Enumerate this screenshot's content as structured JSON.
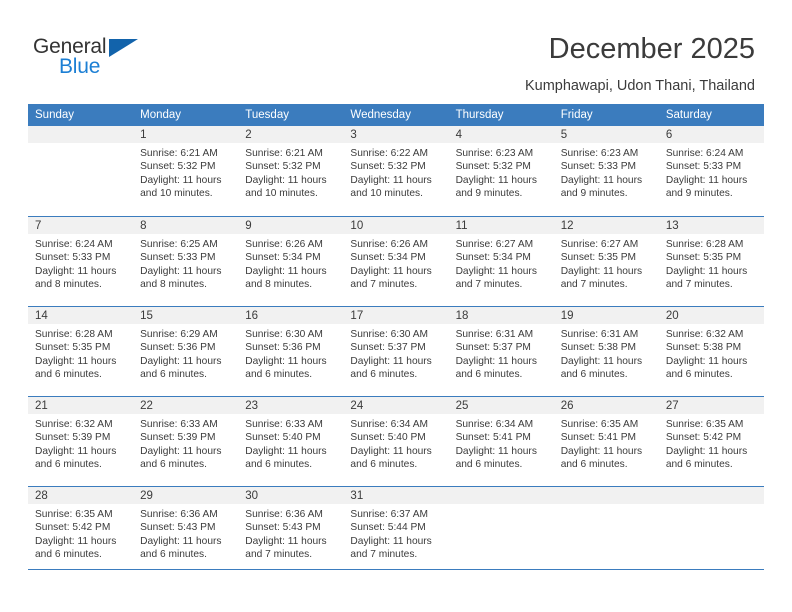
{
  "brand": {
    "name_part1": "General",
    "name_part2": "Blue",
    "accent_color": "#1c7fd4",
    "triangle_color": "#1263ab"
  },
  "header": {
    "title": "December 2025",
    "subtitle": "Kumphawapi, Udon Thani, Thailand"
  },
  "calendar": {
    "header_bg": "#3b7cbe",
    "daynum_bg": "#f1f1f1",
    "weekdays": [
      "Sunday",
      "Monday",
      "Tuesday",
      "Wednesday",
      "Thursday",
      "Friday",
      "Saturday"
    ],
    "weeks": [
      [
        {
          "day": "",
          "sunrise": "",
          "sunset": "",
          "daylight_line1": "",
          "daylight_line2": ""
        },
        {
          "day": "1",
          "sunrise": "Sunrise: 6:21 AM",
          "sunset": "Sunset: 5:32 PM",
          "daylight_line1": "Daylight: 11 hours",
          "daylight_line2": "and 10 minutes."
        },
        {
          "day": "2",
          "sunrise": "Sunrise: 6:21 AM",
          "sunset": "Sunset: 5:32 PM",
          "daylight_line1": "Daylight: 11 hours",
          "daylight_line2": "and 10 minutes."
        },
        {
          "day": "3",
          "sunrise": "Sunrise: 6:22 AM",
          "sunset": "Sunset: 5:32 PM",
          "daylight_line1": "Daylight: 11 hours",
          "daylight_line2": "and 10 minutes."
        },
        {
          "day": "4",
          "sunrise": "Sunrise: 6:23 AM",
          "sunset": "Sunset: 5:32 PM",
          "daylight_line1": "Daylight: 11 hours",
          "daylight_line2": "and 9 minutes."
        },
        {
          "day": "5",
          "sunrise": "Sunrise: 6:23 AM",
          "sunset": "Sunset: 5:33 PM",
          "daylight_line1": "Daylight: 11 hours",
          "daylight_line2": "and 9 minutes."
        },
        {
          "day": "6",
          "sunrise": "Sunrise: 6:24 AM",
          "sunset": "Sunset: 5:33 PM",
          "daylight_line1": "Daylight: 11 hours",
          "daylight_line2": "and 9 minutes."
        }
      ],
      [
        {
          "day": "7",
          "sunrise": "Sunrise: 6:24 AM",
          "sunset": "Sunset: 5:33 PM",
          "daylight_line1": "Daylight: 11 hours",
          "daylight_line2": "and 8 minutes."
        },
        {
          "day": "8",
          "sunrise": "Sunrise: 6:25 AM",
          "sunset": "Sunset: 5:33 PM",
          "daylight_line1": "Daylight: 11 hours",
          "daylight_line2": "and 8 minutes."
        },
        {
          "day": "9",
          "sunrise": "Sunrise: 6:26 AM",
          "sunset": "Sunset: 5:34 PM",
          "daylight_line1": "Daylight: 11 hours",
          "daylight_line2": "and 8 minutes."
        },
        {
          "day": "10",
          "sunrise": "Sunrise: 6:26 AM",
          "sunset": "Sunset: 5:34 PM",
          "daylight_line1": "Daylight: 11 hours",
          "daylight_line2": "and 7 minutes."
        },
        {
          "day": "11",
          "sunrise": "Sunrise: 6:27 AM",
          "sunset": "Sunset: 5:34 PM",
          "daylight_line1": "Daylight: 11 hours",
          "daylight_line2": "and 7 minutes."
        },
        {
          "day": "12",
          "sunrise": "Sunrise: 6:27 AM",
          "sunset": "Sunset: 5:35 PM",
          "daylight_line1": "Daylight: 11 hours",
          "daylight_line2": "and 7 minutes."
        },
        {
          "day": "13",
          "sunrise": "Sunrise: 6:28 AM",
          "sunset": "Sunset: 5:35 PM",
          "daylight_line1": "Daylight: 11 hours",
          "daylight_line2": "and 7 minutes."
        }
      ],
      [
        {
          "day": "14",
          "sunrise": "Sunrise: 6:28 AM",
          "sunset": "Sunset: 5:35 PM",
          "daylight_line1": "Daylight: 11 hours",
          "daylight_line2": "and 6 minutes."
        },
        {
          "day": "15",
          "sunrise": "Sunrise: 6:29 AM",
          "sunset": "Sunset: 5:36 PM",
          "daylight_line1": "Daylight: 11 hours",
          "daylight_line2": "and 6 minutes."
        },
        {
          "day": "16",
          "sunrise": "Sunrise: 6:30 AM",
          "sunset": "Sunset: 5:36 PM",
          "daylight_line1": "Daylight: 11 hours",
          "daylight_line2": "and 6 minutes."
        },
        {
          "day": "17",
          "sunrise": "Sunrise: 6:30 AM",
          "sunset": "Sunset: 5:37 PM",
          "daylight_line1": "Daylight: 11 hours",
          "daylight_line2": "and 6 minutes."
        },
        {
          "day": "18",
          "sunrise": "Sunrise: 6:31 AM",
          "sunset": "Sunset: 5:37 PM",
          "daylight_line1": "Daylight: 11 hours",
          "daylight_line2": "and 6 minutes."
        },
        {
          "day": "19",
          "sunrise": "Sunrise: 6:31 AM",
          "sunset": "Sunset: 5:38 PM",
          "daylight_line1": "Daylight: 11 hours",
          "daylight_line2": "and 6 minutes."
        },
        {
          "day": "20",
          "sunrise": "Sunrise: 6:32 AM",
          "sunset": "Sunset: 5:38 PM",
          "daylight_line1": "Daylight: 11 hours",
          "daylight_line2": "and 6 minutes."
        }
      ],
      [
        {
          "day": "21",
          "sunrise": "Sunrise: 6:32 AM",
          "sunset": "Sunset: 5:39 PM",
          "daylight_line1": "Daylight: 11 hours",
          "daylight_line2": "and 6 minutes."
        },
        {
          "day": "22",
          "sunrise": "Sunrise: 6:33 AM",
          "sunset": "Sunset: 5:39 PM",
          "daylight_line1": "Daylight: 11 hours",
          "daylight_line2": "and 6 minutes."
        },
        {
          "day": "23",
          "sunrise": "Sunrise: 6:33 AM",
          "sunset": "Sunset: 5:40 PM",
          "daylight_line1": "Daylight: 11 hours",
          "daylight_line2": "and 6 minutes."
        },
        {
          "day": "24",
          "sunrise": "Sunrise: 6:34 AM",
          "sunset": "Sunset: 5:40 PM",
          "daylight_line1": "Daylight: 11 hours",
          "daylight_line2": "and 6 minutes."
        },
        {
          "day": "25",
          "sunrise": "Sunrise: 6:34 AM",
          "sunset": "Sunset: 5:41 PM",
          "daylight_line1": "Daylight: 11 hours",
          "daylight_line2": "and 6 minutes."
        },
        {
          "day": "26",
          "sunrise": "Sunrise: 6:35 AM",
          "sunset": "Sunset: 5:41 PM",
          "daylight_line1": "Daylight: 11 hours",
          "daylight_line2": "and 6 minutes."
        },
        {
          "day": "27",
          "sunrise": "Sunrise: 6:35 AM",
          "sunset": "Sunset: 5:42 PM",
          "daylight_line1": "Daylight: 11 hours",
          "daylight_line2": "and 6 minutes."
        }
      ],
      [
        {
          "day": "28",
          "sunrise": "Sunrise: 6:35 AM",
          "sunset": "Sunset: 5:42 PM",
          "daylight_line1": "Daylight: 11 hours",
          "daylight_line2": "and 6 minutes."
        },
        {
          "day": "29",
          "sunrise": "Sunrise: 6:36 AM",
          "sunset": "Sunset: 5:43 PM",
          "daylight_line1": "Daylight: 11 hours",
          "daylight_line2": "and 6 minutes."
        },
        {
          "day": "30",
          "sunrise": "Sunrise: 6:36 AM",
          "sunset": "Sunset: 5:43 PM",
          "daylight_line1": "Daylight: 11 hours",
          "daylight_line2": "and 7 minutes."
        },
        {
          "day": "31",
          "sunrise": "Sunrise: 6:37 AM",
          "sunset": "Sunset: 5:44 PM",
          "daylight_line1": "Daylight: 11 hours",
          "daylight_line2": "and 7 minutes."
        },
        {
          "day": "",
          "sunrise": "",
          "sunset": "",
          "daylight_line1": "",
          "daylight_line2": ""
        },
        {
          "day": "",
          "sunrise": "",
          "sunset": "",
          "daylight_line1": "",
          "daylight_line2": ""
        },
        {
          "day": "",
          "sunrise": "",
          "sunset": "",
          "daylight_line1": "",
          "daylight_line2": ""
        }
      ]
    ]
  }
}
